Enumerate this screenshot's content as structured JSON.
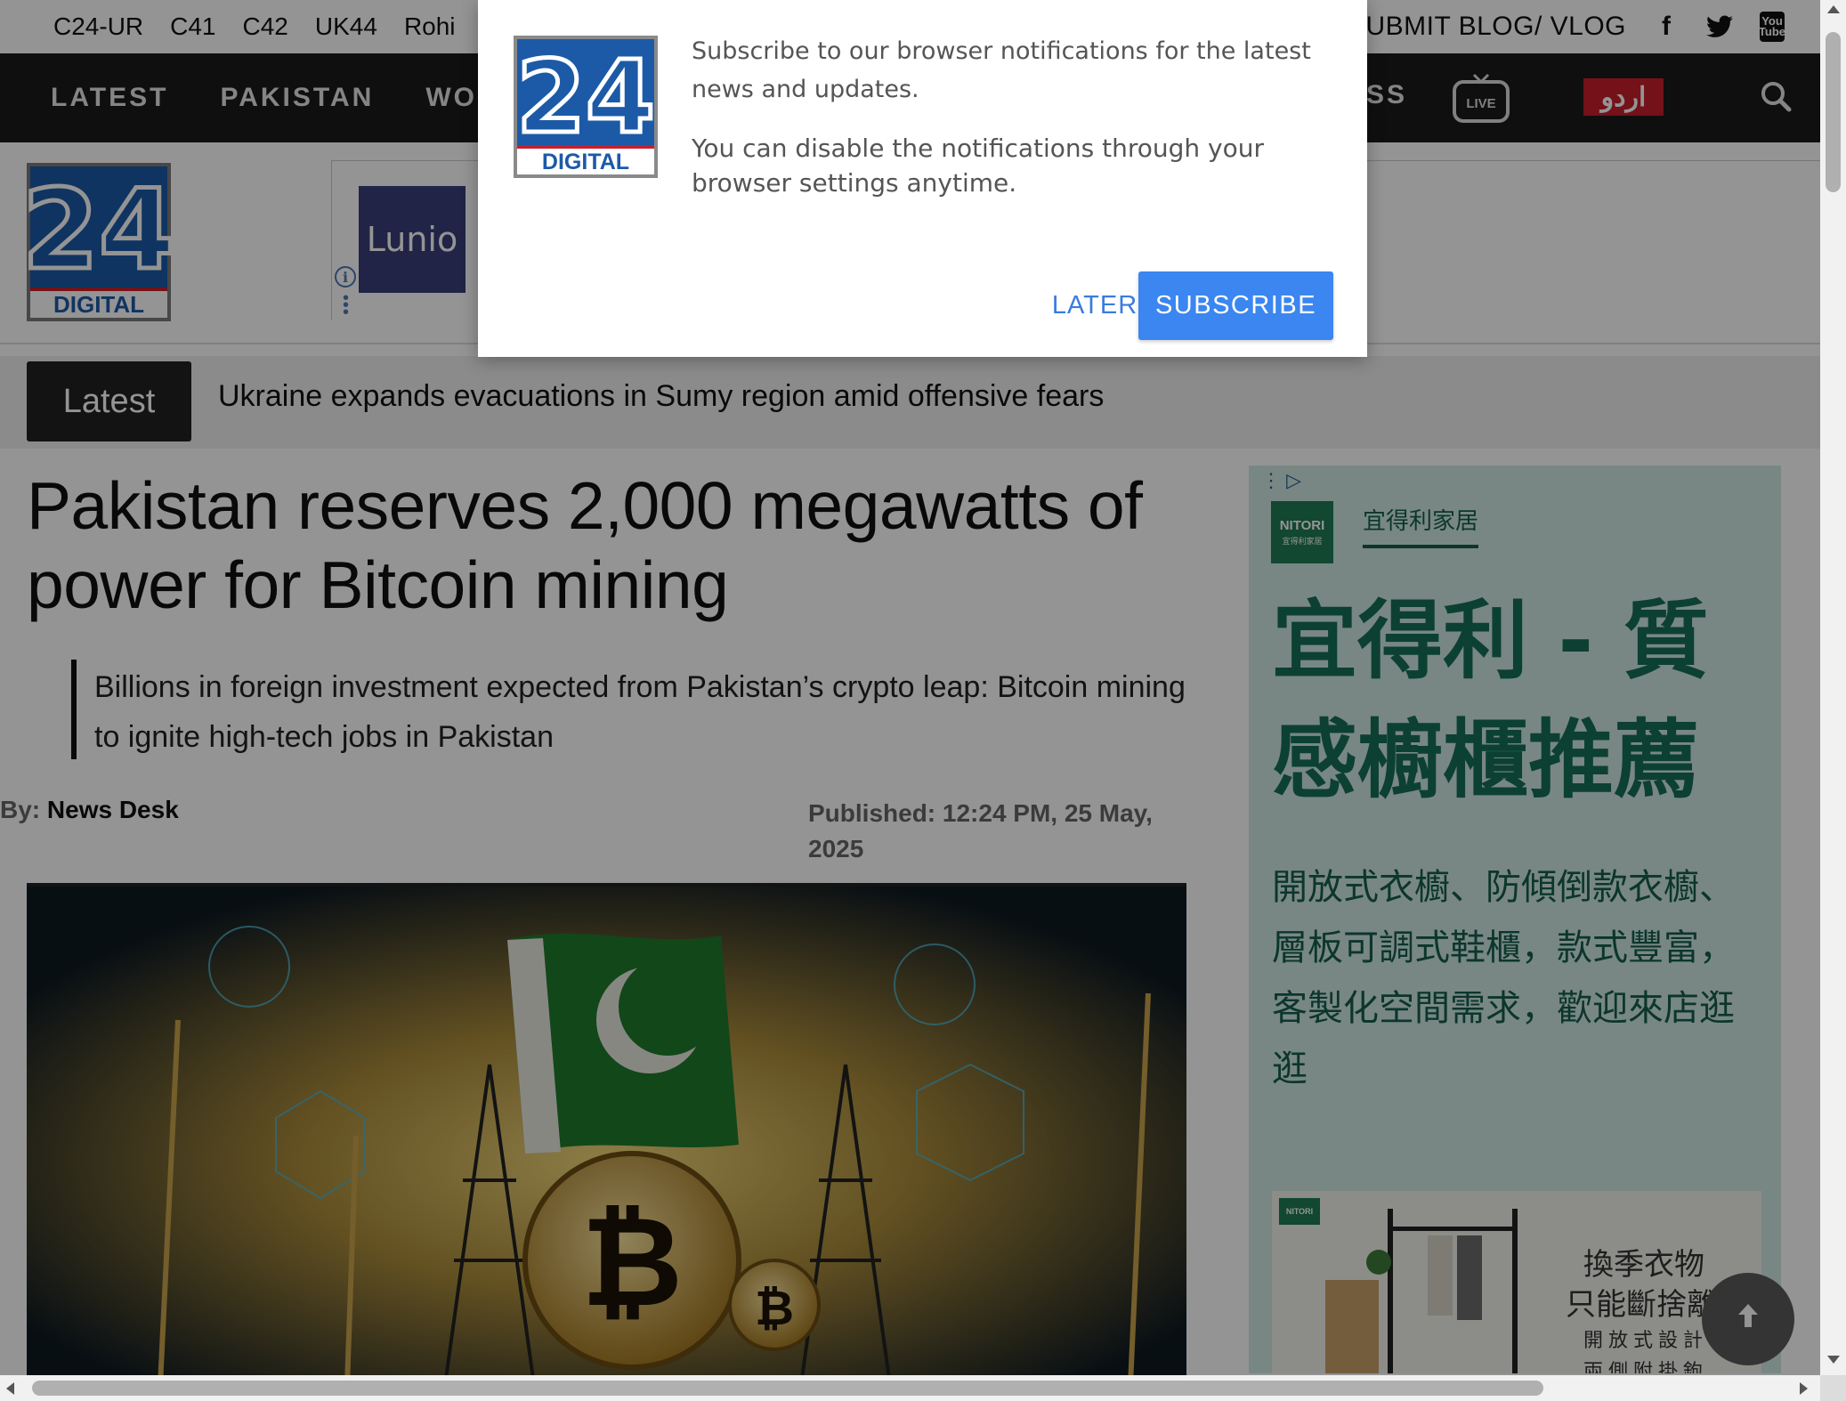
{
  "topbar": {
    "channels": [
      "C24-UR",
      "C41",
      "C42",
      "UK44",
      "Rohi"
    ],
    "submit_label": "SUBMIT BLOG/ VLOG",
    "social": {
      "facebook": "f",
      "twitter": "twitter-icon",
      "youtube_top": "You",
      "youtube_bottom": "Tube"
    }
  },
  "nav": {
    "items": [
      "LATEST",
      "PAKISTAN",
      "WORLD"
    ],
    "partial_item": "SS",
    "live_label": "LIVE",
    "urdu_label": "اردو"
  },
  "logo": {
    "number": "24",
    "word": "DIGITAL",
    "colors": {
      "blue": "#1c5aa8",
      "red": "#c81e2b"
    }
  },
  "ad_banner": {
    "brand": "Lunio"
  },
  "ticker": {
    "tag": "Latest",
    "headline": "Ukraine expands evacuations in Sumy region amid offensive fears"
  },
  "article": {
    "title": "Pakistan reserves 2,000 megawatts of power for Bitcoin mining",
    "dek": "Billions in foreign investment expected from Pakistan’s crypto leap: Bitcoin mining to ignite high-tech jobs in Pakistan",
    "by_label": "By:",
    "author": "News Desk",
    "published": "Published: 12:24 PM, 25 May, 2025"
  },
  "side_ad": {
    "logo_en": "NITORI",
    "logo_zh": "宜得利家居",
    "brand_zh": "宜得利家居",
    "headline_zh": "宜得利 - 質感櫥櫃推薦",
    "body_zh": "開放式衣櫥、防傾倒款衣櫥、層板可調式鞋櫃，款式豐富，客製化空間需求，歡迎來店逛逛",
    "photo_logo": "NITORI",
    "photo_line1": "換季衣物",
    "photo_line2": "只能斷捨離?",
    "photo_line3": "開放式設計",
    "photo_line4": "兩側附掛鉤"
  },
  "dialog": {
    "message1": "Subscribe to our browser notifications for the latest news and updates.",
    "message2": "You can disable the notifications through your browser settings anytime.",
    "later_label": "LATER",
    "subscribe_label": "SUBSCRIBE",
    "accent": "#3b86f0"
  }
}
